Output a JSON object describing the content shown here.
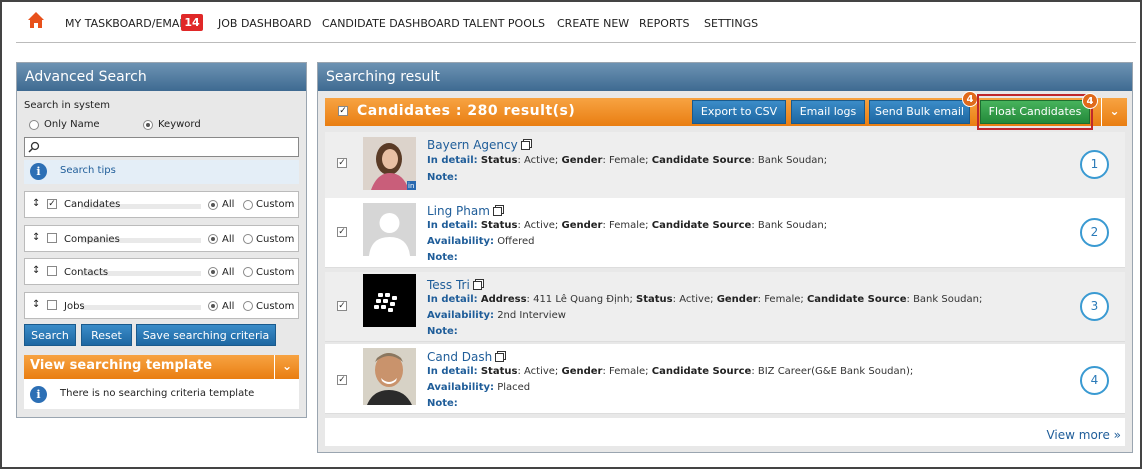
{
  "nav": {
    "items": [
      "MY TASKBOARD/EMAIL",
      "JOB DASHBOARD",
      "CANDIDATE DASHBOARD",
      "TALENT POOLS",
      "CREATE NEW",
      "REPORTS",
      "SETTINGS"
    ],
    "taskboard_badge": "14"
  },
  "left": {
    "title": "Advanced Search",
    "search_in_system": "Search in system",
    "only_name": "Only Name",
    "keyword": "Keyword",
    "search_value": "",
    "search_tips": "Search tips",
    "groups": [
      {
        "label": "Candidates",
        "checked": true,
        "all": "All",
        "custom": "Custom"
      },
      {
        "label": "Companies",
        "checked": false,
        "all": "All",
        "custom": "Custom"
      },
      {
        "label": "Contacts",
        "checked": false,
        "all": "All",
        "custom": "Custom"
      },
      {
        "label": "Jobs",
        "checked": false,
        "all": "All",
        "custom": "Custom"
      }
    ],
    "buttons": {
      "search": "Search",
      "reset": "Reset",
      "save": "Save searching criteria"
    },
    "template_title": "View searching template",
    "template_empty": "There is no searching criteria template"
  },
  "right": {
    "title": "Searching result",
    "results_header": "Candidates : 280 result(s)",
    "buttons": {
      "export": "Export to CSV",
      "email_logs": "Email logs",
      "bulk_email": "Send Bulk email",
      "float": "Float Candidates"
    },
    "bulk_badge": "4",
    "float_badge": "4",
    "view_more": "View more »",
    "rows": [
      {
        "name": "Bayern Agency",
        "detail_label": "In detail:",
        "detail_pre": "",
        "status_label": "Status",
        "status": ": Active;",
        "gender_label": "Gender",
        "gender": ": Female;",
        "source_label": "Candidate Source",
        "source": ": Bank Soudan;",
        "availability_label": "",
        "availability": "",
        "note_label": "Note:",
        "num": "1"
      },
      {
        "name": "Ling Pham",
        "detail_label": "In detail:",
        "detail_pre": "",
        "status_label": "Status",
        "status": ": Active;",
        "gender_label": "Gender",
        "gender": ": Female;",
        "source_label": "Candidate Source",
        "source": ": Bank Soudan;",
        "availability_label": "Availability:",
        "availability": "Offered",
        "note_label": "Note:",
        "num": "2"
      },
      {
        "name": "Tess Tri",
        "detail_label": "In detail:",
        "address_label": "Address",
        "address": ": 411 Lê Quang Định;",
        "status_label": "Status",
        "status": ": Active;",
        "gender_label": "Gender",
        "gender": ": Female;",
        "source_label": "Candidate Source",
        "source": ": Bank Soudan;",
        "availability_label": "Availability:",
        "availability": "2nd Interview",
        "note_label": "Note:",
        "num": "3"
      },
      {
        "name": "Cand Dash",
        "detail_label": "In detail:",
        "detail_pre": "",
        "status_label": "Status",
        "status": ": Active;",
        "gender_label": "Gender",
        "gender": ": Female;",
        "source_label": "Candidate Source",
        "source": ": BIZ Career(G&E Bank Soudan);",
        "availability_label": "Availability:",
        "availability": "Placed",
        "note_label": "Note:",
        "num": "4"
      }
    ]
  },
  "colors": {
    "accent_orange": "#f08a1c",
    "accent_blue": "#2a72b0",
    "float_green": "#2e9e48",
    "badge_red": "#e02828"
  }
}
